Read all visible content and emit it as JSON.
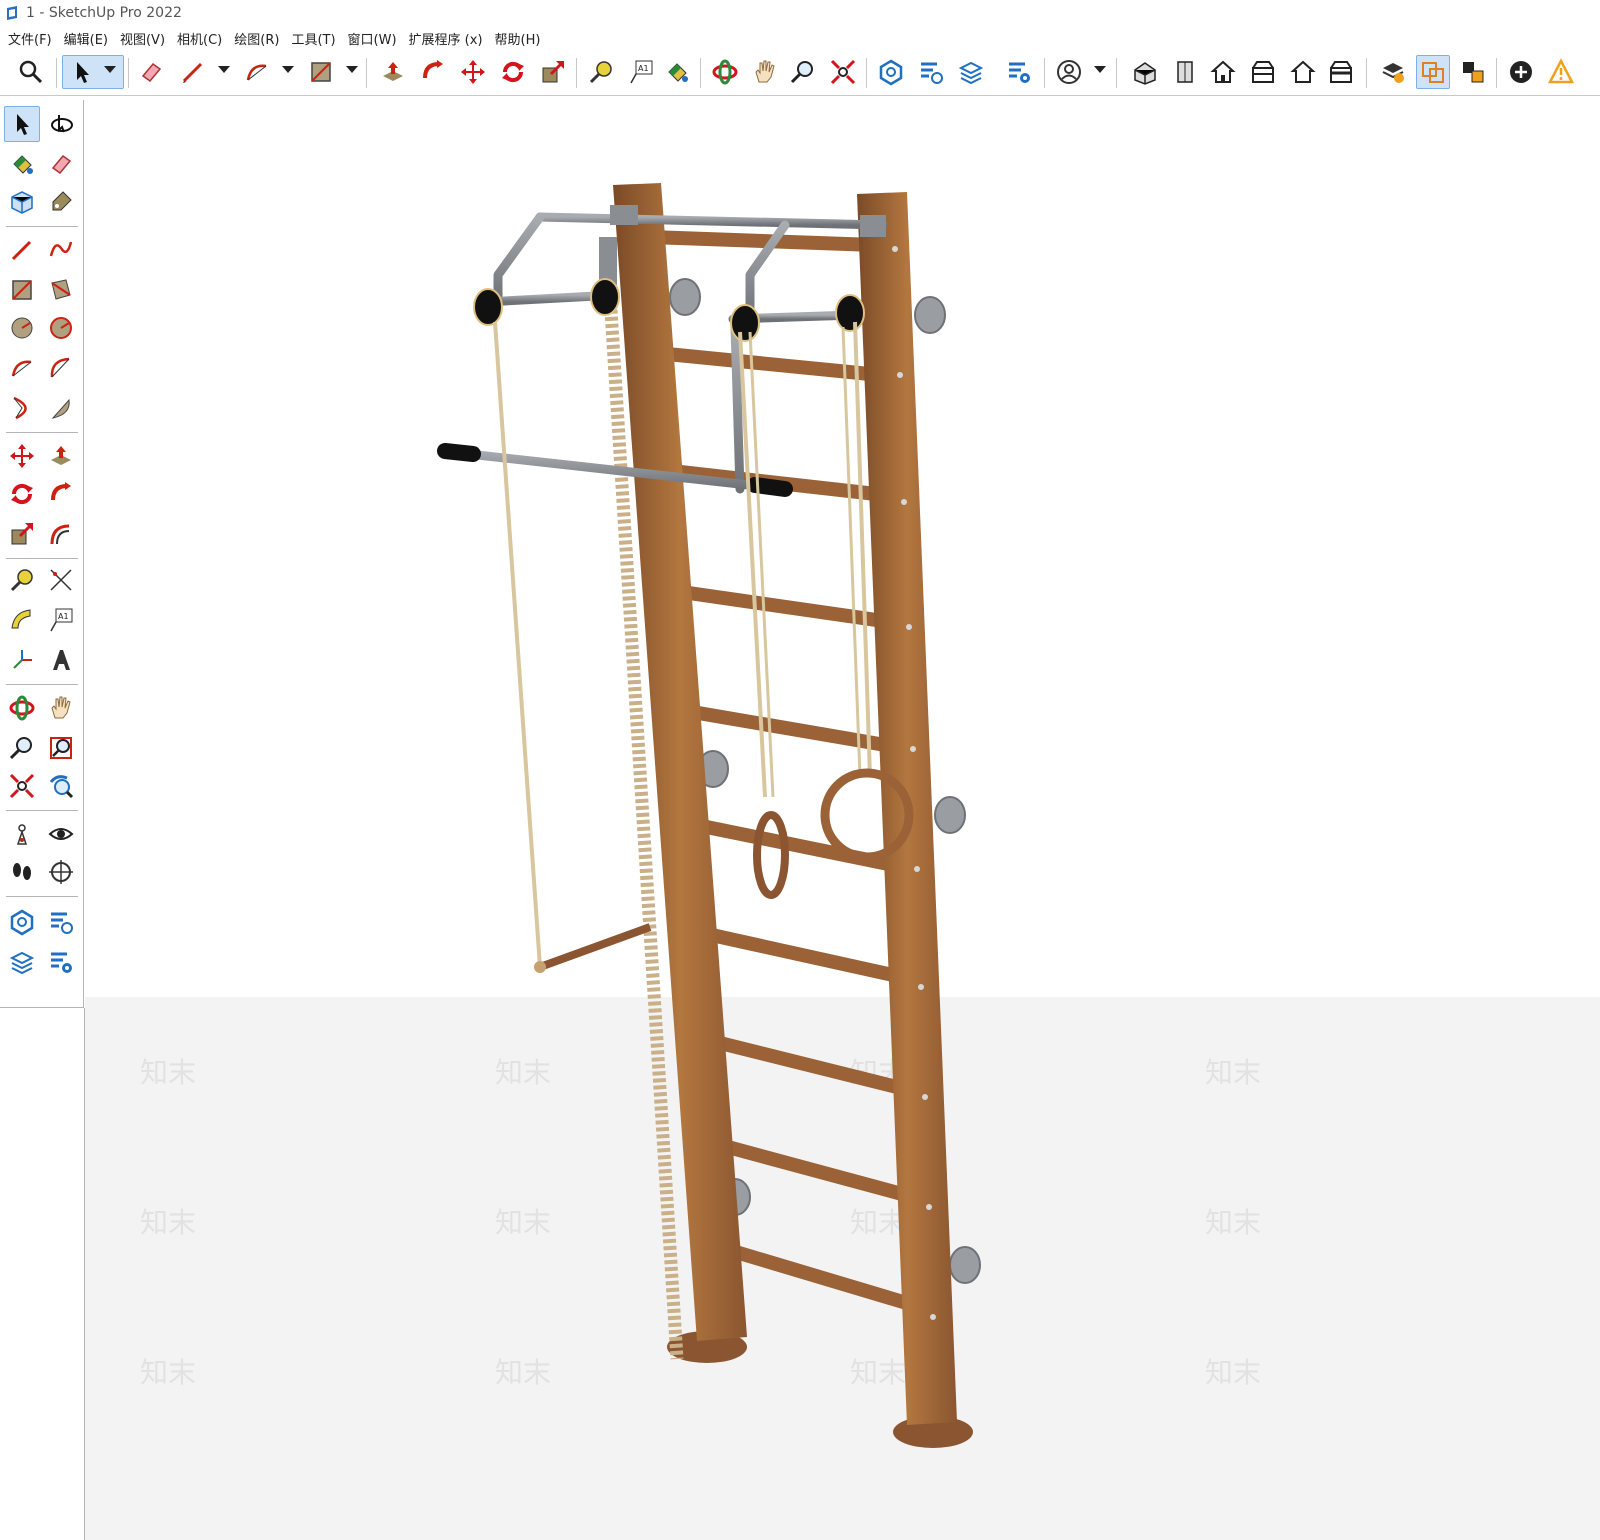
{
  "window": {
    "title": "1 - SketchUp Pro 2022"
  },
  "menu": {
    "items": [
      "文件(F)",
      "编辑(E)",
      "视图(V)",
      "相机(C)",
      "绘图(R)",
      "工具(T)",
      "窗口(W)",
      "扩展程序 (x)",
      "帮助(H)"
    ]
  },
  "toolbar": {
    "tools": [
      "search-icon",
      "select-icon",
      "eraser-icon",
      "pencil-icon",
      "arc-icon",
      "rectangle-icon",
      "push-pull-icon",
      "follow-me-icon",
      "move-icon",
      "rotate-icon",
      "scale-icon",
      "tape-measure-icon",
      "text-icon",
      "paint-bucket-icon",
      "orbit-icon",
      "pan-icon",
      "zoom-icon",
      "zoom-extents-icon",
      "warehouse-icon",
      "extension-warehouse-icon",
      "layout-icon",
      "extension-manager-icon",
      "profile-icon",
      "iso-view-icon",
      "top-view-icon",
      "front-view-icon",
      "right-view-icon",
      "back-view-icon",
      "left-view-icon",
      "solid-inspector-icon",
      "outliner-icon",
      "scenes-icon",
      "add-icon",
      "warning-icon"
    ]
  },
  "lefttray": {
    "tools": [
      "select-icon",
      "orbit-icon",
      "paint-bucket-icon",
      "eraser-icon",
      "component-icon",
      "tag-icon",
      "line-icon",
      "freehand-icon",
      "rectangle-icon",
      "rotated-rectangle-icon",
      "circle-icon",
      "polygon-icon",
      "arc-icon",
      "2-point-arc-icon",
      "3-point-arc-icon",
      "pie-icon",
      "move-icon",
      "push-pull-icon",
      "rotate-icon",
      "follow-me-icon",
      "scale-icon",
      "offset-icon",
      "tape-measure-icon",
      "dimension-icon",
      "protractor-icon",
      "text-icon",
      "axes-icon",
      "3d-text-icon",
      "orbit-icon",
      "pan-icon",
      "zoom-icon",
      "zoom-window-icon",
      "zoom-extents-icon",
      "previous-view-icon",
      "position-camera-icon",
      "look-around-icon",
      "walk-icon",
      "section-plane-icon",
      "warehouse-icon",
      "extension-warehouse-icon",
      "layout-icon",
      "extension-manager-icon"
    ]
  },
  "colors": {
    "wood": "#a0663a",
    "wood_dark": "#7a4a27",
    "metal": "#8a8d92",
    "rope": "#d8c79e",
    "accent_blue": "#1f6fc2",
    "icon_red": "#d4141c",
    "selected_bg": "#cfe3f8"
  },
  "watermark": {
    "text": "知末"
  }
}
